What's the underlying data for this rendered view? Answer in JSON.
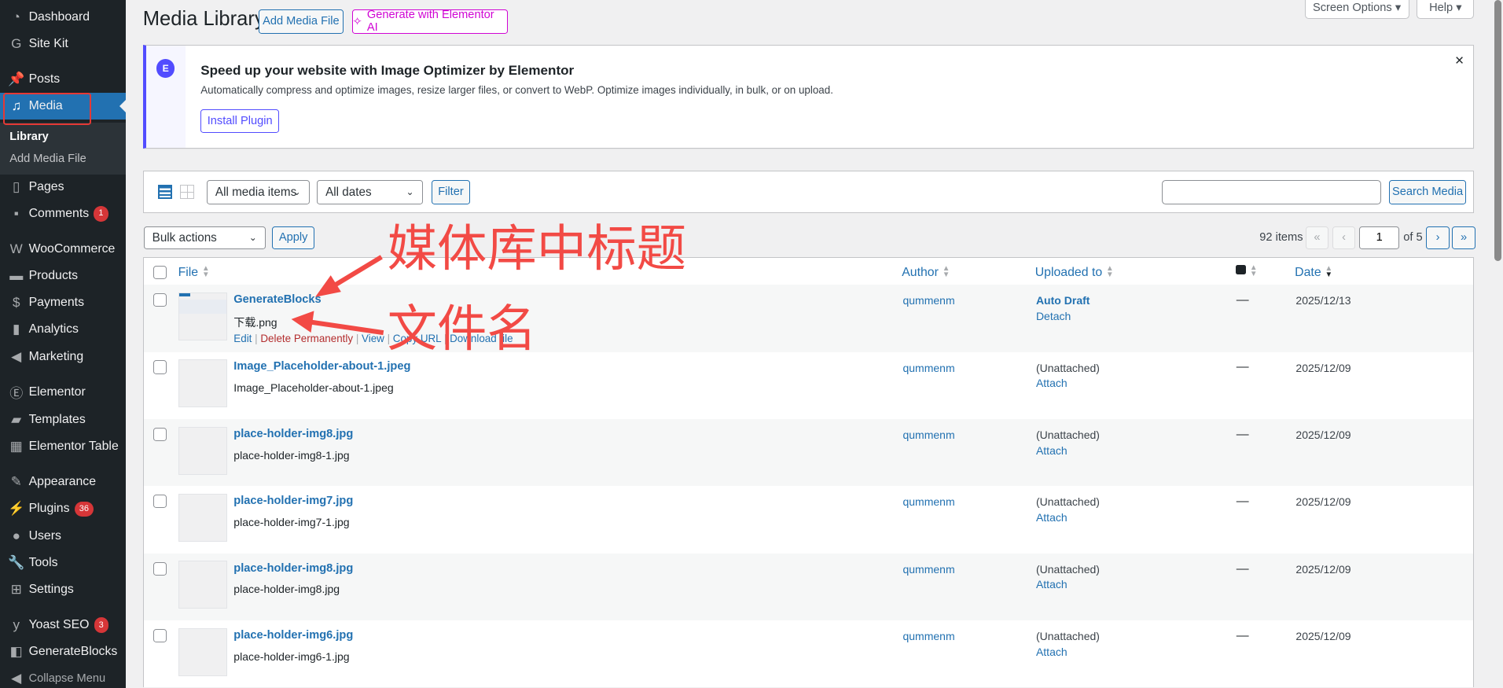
{
  "sidebar": {
    "items": [
      {
        "label": "Dashboard",
        "icon": "dashboard-icon"
      },
      {
        "label": "Site Kit",
        "icon": "google-g-icon"
      },
      {
        "label": "Posts",
        "icon": "pin-icon"
      },
      {
        "label": "Media",
        "icon": "media-icon"
      },
      {
        "label": "Pages",
        "icon": "pages-icon"
      },
      {
        "label": "Comments",
        "icon": "comment-icon",
        "badge": "1"
      },
      {
        "label": "WooCommerce",
        "icon": "woo-icon"
      },
      {
        "label": "Products",
        "icon": "archive-icon"
      },
      {
        "label": "Payments",
        "icon": "dollar-icon"
      },
      {
        "label": "Analytics",
        "icon": "bar-chart-icon"
      },
      {
        "label": "Marketing",
        "icon": "megaphone-icon"
      },
      {
        "label": "Elementor",
        "icon": "elementor-icon"
      },
      {
        "label": "Templates",
        "icon": "folder-icon"
      },
      {
        "label": "Elementor Table",
        "icon": "table-icon"
      },
      {
        "label": "Appearance",
        "icon": "brush-icon"
      },
      {
        "label": "Plugins",
        "icon": "plug-icon",
        "badge": "36"
      },
      {
        "label": "Users",
        "icon": "user-icon"
      },
      {
        "label": "Tools",
        "icon": "wrench-icon"
      },
      {
        "label": "Settings",
        "icon": "settings-icon"
      },
      {
        "label": "Yoast SEO",
        "icon": "yoast-icon",
        "badge": "3"
      },
      {
        "label": "GenerateBlocks",
        "icon": "generateblocks-icon"
      },
      {
        "label": "Collapse Menu",
        "icon": "collapse-icon"
      }
    ],
    "submenu": [
      "Library",
      "Add Media File"
    ]
  },
  "header": {
    "title": "Media Library",
    "add_button": "Add Media File",
    "ai_button": "Generate with Elementor AI",
    "screen_options": "Screen Options",
    "help": "Help"
  },
  "notice": {
    "title": "Speed up your website with Image Optimizer by Elementor",
    "description": "Automatically compress and optimize images, resize larger files, or convert to WebP. Optimize images individually, in bulk, or on upload.",
    "button": "Install Plugin",
    "close": "×"
  },
  "filters": {
    "type_select": "All media items",
    "date_select": "All dates",
    "filter_button": "Filter",
    "search_value": "",
    "search_button": "Search Media"
  },
  "bulk": {
    "select": "Bulk actions",
    "apply": "Apply"
  },
  "pagination": {
    "count": "92 items",
    "first": "«",
    "prev": "‹",
    "page": "1",
    "of": "of 5",
    "next": "›",
    "last": "»"
  },
  "table": {
    "headers": {
      "file": "File",
      "author": "Author",
      "uploaded_to": "Uploaded to",
      "date": "Date"
    },
    "rows": [
      {
        "title": "GenerateBlocks",
        "filename": "下载.png",
        "author": "qummenm",
        "uploaded": "Auto Draft",
        "action": "Detach",
        "comments": "—",
        "date": "2025/12/13",
        "row_actions": [
          "Edit",
          "Delete Permanently",
          "View",
          "Copy URL",
          "Download file"
        ]
      },
      {
        "title": "Image_Placeholder-about-1.jpeg",
        "filename": "Image_Placeholder-about-1.jpeg",
        "author": "qummenm",
        "uploaded": "(Unattached)",
        "action": "Attach",
        "comments": "—",
        "date": "2025/12/09"
      },
      {
        "title": "place-holder-img8.jpg",
        "filename": "place-holder-img8-1.jpg",
        "author": "qummenm",
        "uploaded": "(Unattached)",
        "action": "Attach",
        "comments": "—",
        "date": "2025/12/09"
      },
      {
        "title": "place-holder-img7.jpg",
        "filename": "place-holder-img7-1.jpg",
        "author": "qummenm",
        "uploaded": "(Unattached)",
        "action": "Attach",
        "comments": "—",
        "date": "2025/12/09"
      },
      {
        "title": "place-holder-img8.jpg",
        "filename": "place-holder-img8.jpg",
        "author": "qummenm",
        "uploaded": "(Unattached)",
        "action": "Attach",
        "comments": "—",
        "date": "2025/12/09"
      },
      {
        "title": "place-holder-img6.jpg",
        "filename": "place-holder-img6-1.jpg",
        "author": "qummenm",
        "uploaded": "(Unattached)",
        "action": "Attach",
        "comments": "—",
        "date": "2025/12/09"
      }
    ]
  },
  "annotations": {
    "title_note": "媒体库中标题",
    "filename_note": "文件名"
  }
}
